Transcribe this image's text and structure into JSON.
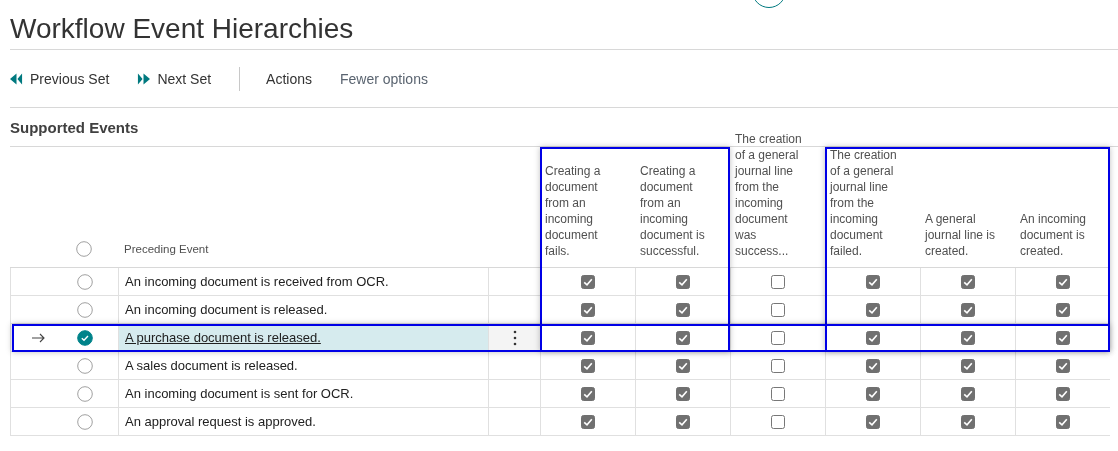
{
  "page": {
    "title": "Workflow Event Hierarchies"
  },
  "toolbar": [
    {
      "kind": "previous",
      "label": "Previous Set"
    },
    {
      "kind": "next",
      "label": "Next Set"
    },
    {
      "kind": "separator"
    },
    {
      "kind": "plain",
      "label": "Actions"
    },
    {
      "kind": "muted",
      "label": "Fewer options"
    }
  ],
  "section": {
    "title": "Supported Events"
  },
  "table": {
    "select_all": {
      "checked": false
    },
    "preceding_column": "Preceding Event",
    "event_columns": [
      {
        "label": "Creating a document from an incoming document fails.",
        "highlighted": true
      },
      {
        "label": "Creating a document from an incoming document is successful.",
        "highlighted": true
      },
      {
        "label": "The creation of a general journal line from the incoming document was success...",
        "highlighted": false
      },
      {
        "label": "The creation of a general journal line from the incoming document failed.",
        "highlighted": true
      },
      {
        "label": "A general journal line is created.",
        "highlighted": true
      },
      {
        "label": "An incoming document is created.",
        "highlighted": true
      }
    ],
    "rows": [
      {
        "event": "An incoming document is received from OCR.",
        "selected": false,
        "highlighted": false,
        "checks": [
          true,
          true,
          false,
          true,
          true,
          true
        ]
      },
      {
        "event": "An incoming document is released.",
        "selected": false,
        "highlighted": false,
        "checks": [
          true,
          true,
          false,
          true,
          true,
          true
        ]
      },
      {
        "event": "A purchase document is released.",
        "selected": true,
        "highlighted": true,
        "checks": [
          true,
          true,
          false,
          true,
          true,
          true
        ]
      },
      {
        "event": "A sales document is released.",
        "selected": false,
        "highlighted": false,
        "checks": [
          true,
          true,
          false,
          true,
          true,
          true
        ]
      },
      {
        "event": "An incoming document is sent for OCR.",
        "selected": false,
        "highlighted": false,
        "checks": [
          true,
          true,
          false,
          true,
          true,
          true
        ]
      },
      {
        "event": "An approval request is approved.",
        "selected": false,
        "highlighted": false,
        "checks": [
          true,
          true,
          false,
          true,
          true,
          true
        ]
      }
    ]
  }
}
